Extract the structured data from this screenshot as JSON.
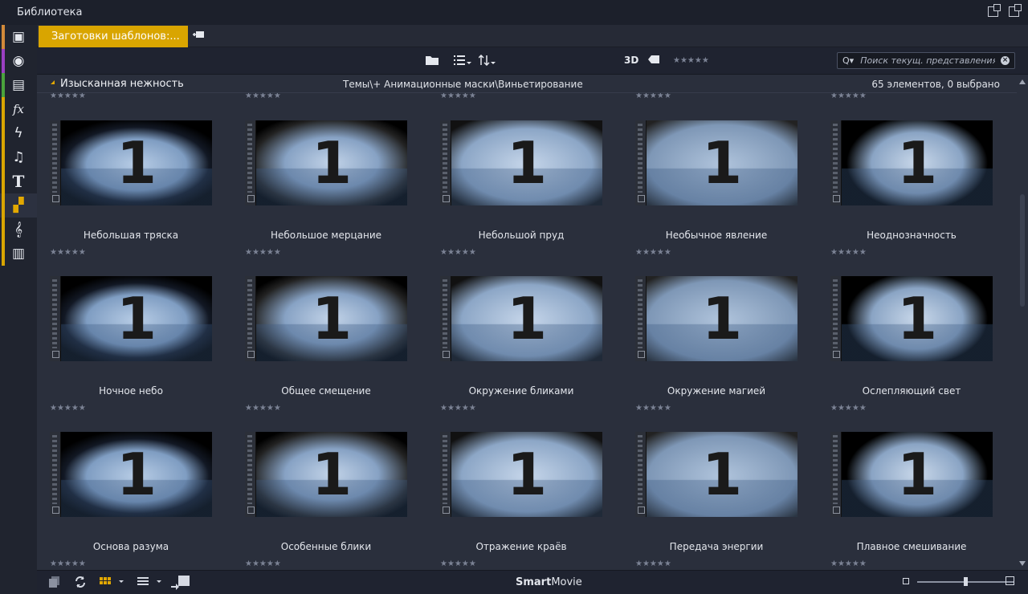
{
  "window": {
    "title": "Библиотека",
    "restore_icon": "restore-window-icon",
    "detach_icon": "detach-window-icon"
  },
  "sidebar": {
    "items": [
      {
        "icon": "box-icon",
        "glyph": "▣",
        "accent": "#d38a3a"
      },
      {
        "icon": "film-reel-icon",
        "glyph": "◉",
        "accent": "#9b3fc2"
      },
      {
        "icon": "photo-stack-icon",
        "glyph": "▤",
        "accent": "#4aa33c"
      },
      {
        "icon": "effects-icon",
        "glyph": "fx",
        "accent": "#d9a500"
      },
      {
        "icon": "lightning-icon",
        "glyph": "ϟ",
        "accent": "#d9a500"
      },
      {
        "icon": "music-note-icon",
        "glyph": "♫",
        "accent": "#d9a500"
      },
      {
        "icon": "title-text-icon",
        "glyph": "T",
        "accent": "#d9a500"
      },
      {
        "icon": "templates-icon",
        "glyph": "▞",
        "accent": "#d9a500"
      },
      {
        "icon": "treble-clef-icon",
        "glyph": "𝄞",
        "accent": "#d9a500"
      },
      {
        "icon": "piano-keys-icon",
        "glyph": "▥",
        "accent": "#d9a500"
      }
    ],
    "active_index": 7
  },
  "tabs": {
    "active_label": "Заготовки шаблонов:...",
    "add_icon": "add-tab-icon"
  },
  "toolbar": {
    "folder_icon": "folder-icon",
    "list_view_icon": "list-view-icon",
    "sort_icon": "sort-icon",
    "label_3d": "3D",
    "tag_icon": "tag-icon",
    "rating": "★★★★★",
    "search": {
      "placeholder": "Поиск текущ. представления",
      "icon": "search-icon",
      "clear_icon": "clear-icon"
    }
  },
  "group": {
    "name": "Изысканная нежность",
    "path": "Темы\\+ Анимационные маски\\Виньетирование",
    "count": "65 элементов, 0 выбрано"
  },
  "items_rating": "★★★★★",
  "items": [
    {
      "label": "Небольшая тряска",
      "number": "1"
    },
    {
      "label": "Небольшое мерцание",
      "number": "1"
    },
    {
      "label": "Небольшой пруд",
      "number": "1"
    },
    {
      "label": "Необычное явление",
      "number": "1"
    },
    {
      "label": "Неоднозначность",
      "number": "1"
    },
    {
      "label": "Ночное небо",
      "number": "1"
    },
    {
      "label": "Общее смещение",
      "number": "1"
    },
    {
      "label": "Окружение бликами",
      "number": "1"
    },
    {
      "label": "Окружение магией",
      "number": "1"
    },
    {
      "label": "Ослепляющий свет",
      "number": "1"
    },
    {
      "label": "Основа разума",
      "number": "1"
    },
    {
      "label": "Особенные блики",
      "number": "1"
    },
    {
      "label": "Отражение краёв",
      "number": "1"
    },
    {
      "label": "Передача энергии",
      "number": "1"
    },
    {
      "label": "Плавное смешивание",
      "number": "1"
    }
  ],
  "bottombar": {
    "brand_bold": "Smart",
    "brand_rest": "Movie",
    "copy_icon": "copy-icon",
    "refresh_icon": "refresh-icon",
    "grid_view_icon": "grid-view-icon",
    "list_menu_icon": "list-menu-icon",
    "send_icon": "send-to-timeline-icon",
    "zoom_level": 0.5
  }
}
